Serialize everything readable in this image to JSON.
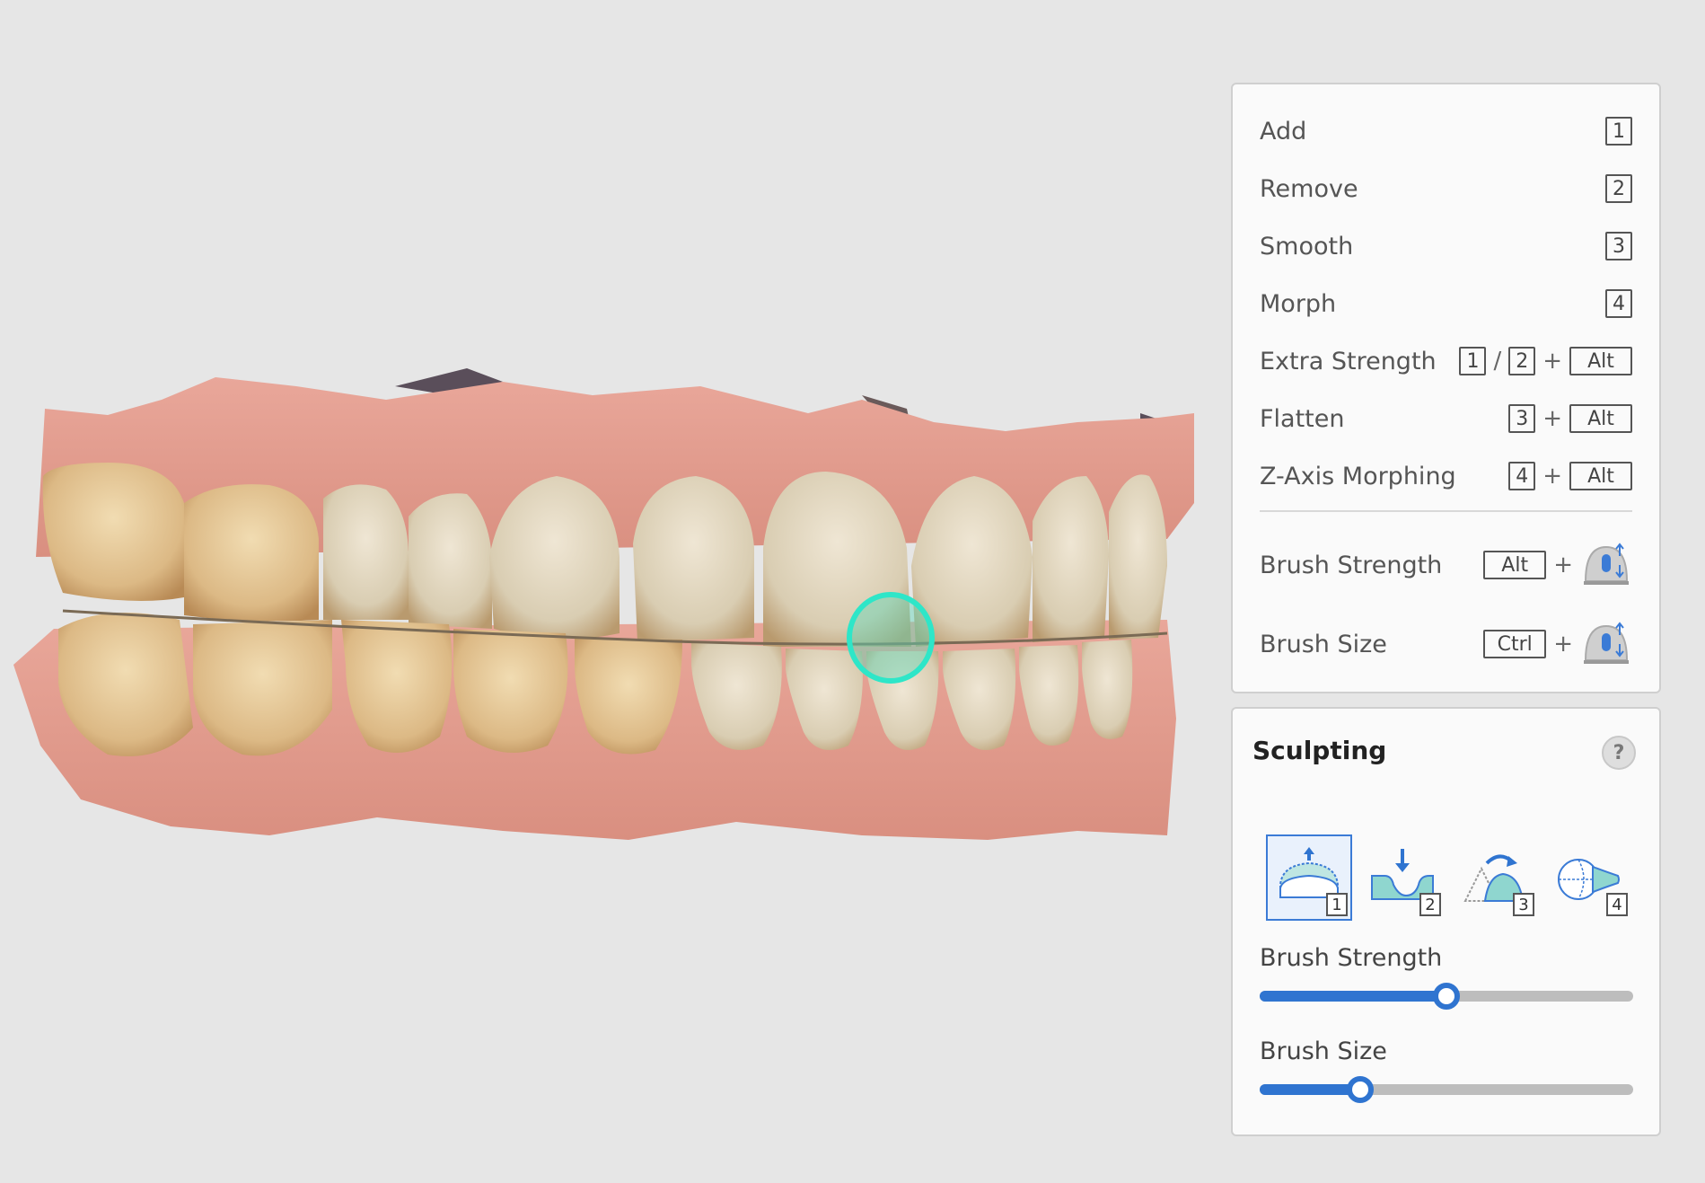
{
  "shortcuts": {
    "add": {
      "label": "Add",
      "key": "1"
    },
    "remove": {
      "label": "Remove",
      "key": "2"
    },
    "smooth": {
      "label": "Smooth",
      "key": "3"
    },
    "morph": {
      "label": "Morph",
      "key": "4"
    },
    "extra_strength": {
      "label": "Extra Strength",
      "key1": "1",
      "slash": "/",
      "key2": "2",
      "plus": "+",
      "mod": "Alt"
    },
    "flatten": {
      "label": "Flatten",
      "key": "3",
      "plus": "+",
      "mod": "Alt"
    },
    "z_axis_morphing": {
      "label": "Z-Axis Morphing",
      "key": "4",
      "plus": "+",
      "mod": "Alt"
    },
    "brush_strength": {
      "label": "Brush Strength",
      "mod": "Alt",
      "plus": "+",
      "icon": "mouse-wheel-icon"
    },
    "brush_size": {
      "label": "Brush Size",
      "mod": "Ctrl",
      "plus": "+",
      "icon": "mouse-wheel-icon"
    }
  },
  "sculpting": {
    "title": "Sculpting",
    "help": "?",
    "tools": [
      {
        "name": "add-tool",
        "num": "1",
        "icon": "add-bump-icon",
        "active": true
      },
      {
        "name": "remove-tool",
        "num": "2",
        "icon": "remove-dent-icon",
        "active": false
      },
      {
        "name": "smooth-tool",
        "num": "3",
        "icon": "smooth-icon",
        "active": false
      },
      {
        "name": "morph-tool",
        "num": "4",
        "icon": "morph-icon",
        "active": false
      }
    ],
    "brush_strength": {
      "label": "Brush Strength",
      "value": 0.5
    },
    "brush_size": {
      "label": "Brush Size",
      "value": 0.27
    }
  },
  "colors": {
    "accent": "#2f74d0",
    "brush_cursor": "#2ee6c8",
    "background": "#e6e6e6"
  }
}
